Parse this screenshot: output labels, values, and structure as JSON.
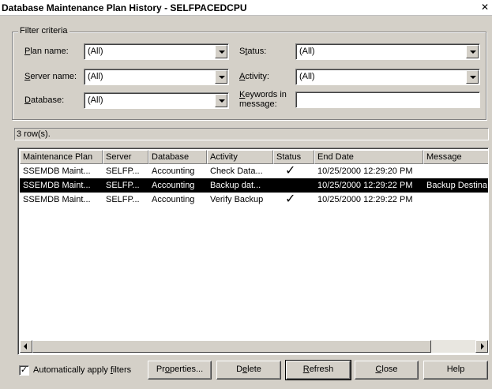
{
  "window": {
    "title": "Database Maintenance Plan History - SELFPACEDCPU",
    "close_glyph": "✕"
  },
  "filter": {
    "group_label": "Filter criteria",
    "plan_name": {
      "label": "Plan name:",
      "mnemonic": "P",
      "rest": "lan name:",
      "value": "(All)"
    },
    "server_name": {
      "label": "Server name:",
      "mnemonic": "S",
      "rest": "erver name:",
      "value": "(All)"
    },
    "database": {
      "label": "Database:",
      "mnemonic": "D",
      "rest": "atabase:",
      "value": "(All)"
    },
    "status": {
      "label": "Status:",
      "pre": "S",
      "mnemonic": "t",
      "rest": "atus:",
      "value": "(All)"
    },
    "activity": {
      "label": "Activity:",
      "mnemonic": "A",
      "rest": "ctivity:",
      "value": "(All)"
    },
    "keywords": {
      "mnemonic": "K",
      "rest_line1": "eywords in",
      "line2": "message:",
      "value": ""
    }
  },
  "status_text": "3 row(s).",
  "table": {
    "columns": [
      "Maintenance Plan",
      "Server",
      "Database",
      "Activity",
      "Status",
      "End Date",
      "Message"
    ],
    "rows": [
      {
        "plan": "SSEMDB Maint...",
        "server": "SELFP...",
        "database": "Accounting",
        "activity": "Check Data...",
        "status": "✓",
        "end_date": "10/25/2000 12:29:20 PM",
        "message": "",
        "selected": false
      },
      {
        "plan": "SSEMDB Maint...",
        "server": "SELFP...",
        "database": "Accounting",
        "activity": "Backup dat...",
        "status": "",
        "end_date": "10/25/2000 12:29:22 PM",
        "message": "Backup Destina",
        "selected": true
      },
      {
        "plan": "SSEMDB Maint...",
        "server": "SELFP...",
        "database": "Accounting",
        "activity": "Verify Backup",
        "status": "✓",
        "end_date": "10/25/2000 12:29:22 PM",
        "message": "",
        "selected": false
      }
    ]
  },
  "footer": {
    "auto_apply": {
      "checked": true,
      "check_glyph": "✓",
      "pre": "Automatically apply ",
      "mnemonic": "f",
      "rest": "ilters"
    },
    "buttons": {
      "properties": {
        "pre": "Pr",
        "mnemonic": "o",
        "rest": "perties..."
      },
      "delete": {
        "pre": "D",
        "mnemonic": "e",
        "rest": "lete"
      },
      "refresh": {
        "pre": "",
        "mnemonic": "R",
        "rest": "efresh"
      },
      "close": {
        "pre": "",
        "mnemonic": "C",
        "rest": "lose"
      },
      "help": {
        "label": "Help"
      }
    }
  },
  "colors": {
    "dialog_bg": "#d4d0c8",
    "selection_bg": "#000000",
    "selection_fg": "#ffffff"
  }
}
